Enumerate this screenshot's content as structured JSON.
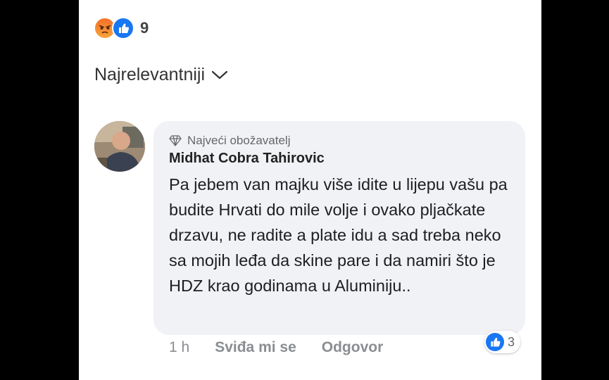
{
  "post": {
    "reactions": {
      "icons": [
        "angry-icon",
        "like-icon"
      ],
      "count": "9"
    },
    "sort_label": "Najrelevantniji"
  },
  "comment": {
    "badge": "Najveći obožavatelj",
    "author": "Midhat Cobra Tahirovic",
    "text": "Pa jebem van majku više idite u lijepu vašu pa budite Hrvati do mile volje i ovako pljačkate drzavu, ne radite a plate idu a sad treba neko sa mojih leđa da skine pare i da namiri što je HDZ krao godinama u Aluminiju..",
    "time": "1 h",
    "like_label": "Sviđa mi se",
    "reply_label": "Odgovor",
    "reaction_count": "3"
  },
  "colors": {
    "like_blue": "#1877f2",
    "angry_orange": "#f4702a",
    "bubble_bg": "#f0f2f5",
    "meta_gray": "#8a8d91"
  }
}
